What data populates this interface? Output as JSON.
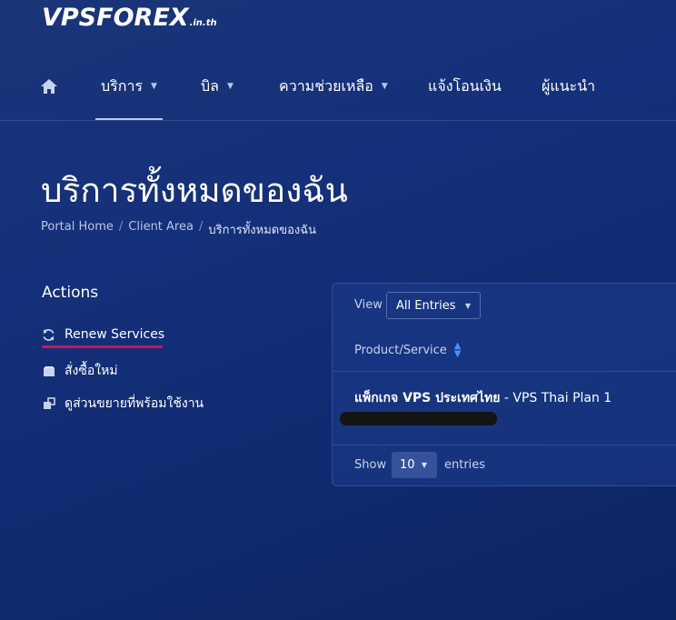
{
  "logo": {
    "main": "VPSFOREX",
    "suffix": ".in.th"
  },
  "nav": {
    "home_icon": "home-icon",
    "items": [
      {
        "label": "บริการ",
        "has_caret": true,
        "active": true
      },
      {
        "label": "บิล",
        "has_caret": true
      },
      {
        "label": "ความช่วยเหลือ",
        "has_caret": true
      },
      {
        "label": "แจ้งโอนเงิน",
        "has_caret": false
      },
      {
        "label": "ผู้แนะนำ",
        "has_caret": false
      }
    ]
  },
  "page": {
    "title": "บริการทั้งหมดของฉัน",
    "breadcrumb": [
      "Portal Home",
      "Client Area",
      "บริการทั้งหมดของฉัน"
    ]
  },
  "actions": {
    "title": "Actions",
    "items": [
      {
        "label": "Renew Services",
        "icon": "refresh-icon"
      },
      {
        "label": "สั่งซื้อใหม่",
        "icon": "box-icon"
      },
      {
        "label": "ดูส่วนขยายที่พร้อมใช้งาน",
        "icon": "addons-icon"
      }
    ]
  },
  "table": {
    "view_label": "View",
    "view_value": "All Entries",
    "column": "Product/Service",
    "rows": [
      {
        "product": "แพ็กเกจ VPS ประเทศไทย",
        "plan": " - VPS Thai Plan 1"
      }
    ],
    "show_label": "Show",
    "entries_value": "10",
    "entries_label": "entries"
  },
  "colors": {
    "accent_underline": "#c2185b",
    "sort_icon": "#4a90ff",
    "background": "#15307a"
  }
}
